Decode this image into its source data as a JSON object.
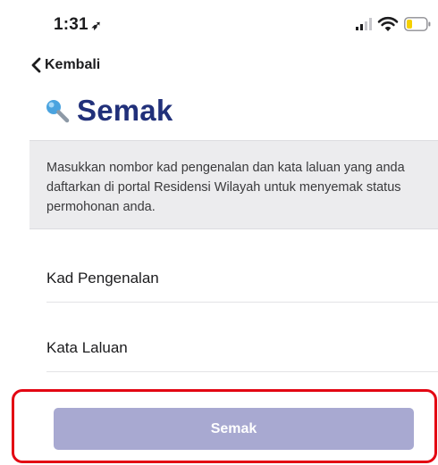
{
  "status_bar": {
    "time": "1:31",
    "location_icon": "location-arrow-icon",
    "icons": [
      "signal-icon",
      "wifi-icon",
      "battery-icon"
    ],
    "battery_color": "#f5d000"
  },
  "nav": {
    "back_label": "Kembali",
    "back_icon": "chevron-left-icon"
  },
  "header": {
    "title": "Semak",
    "icon": "magnifier-icon",
    "title_color": "#21307a"
  },
  "info": {
    "text": "Masukkan nombor kad pengenalan dan kata laluan yang anda daftarkan di portal Residensi Wilayah untuk menyemak status permohonan anda."
  },
  "form": {
    "ic_label": "Kad Pengenalan",
    "ic_value": "",
    "password_label": "Kata Laluan",
    "password_value": ""
  },
  "submit": {
    "label": "Semak",
    "color": "#a8a9d1"
  },
  "highlight_color": "#e30613"
}
